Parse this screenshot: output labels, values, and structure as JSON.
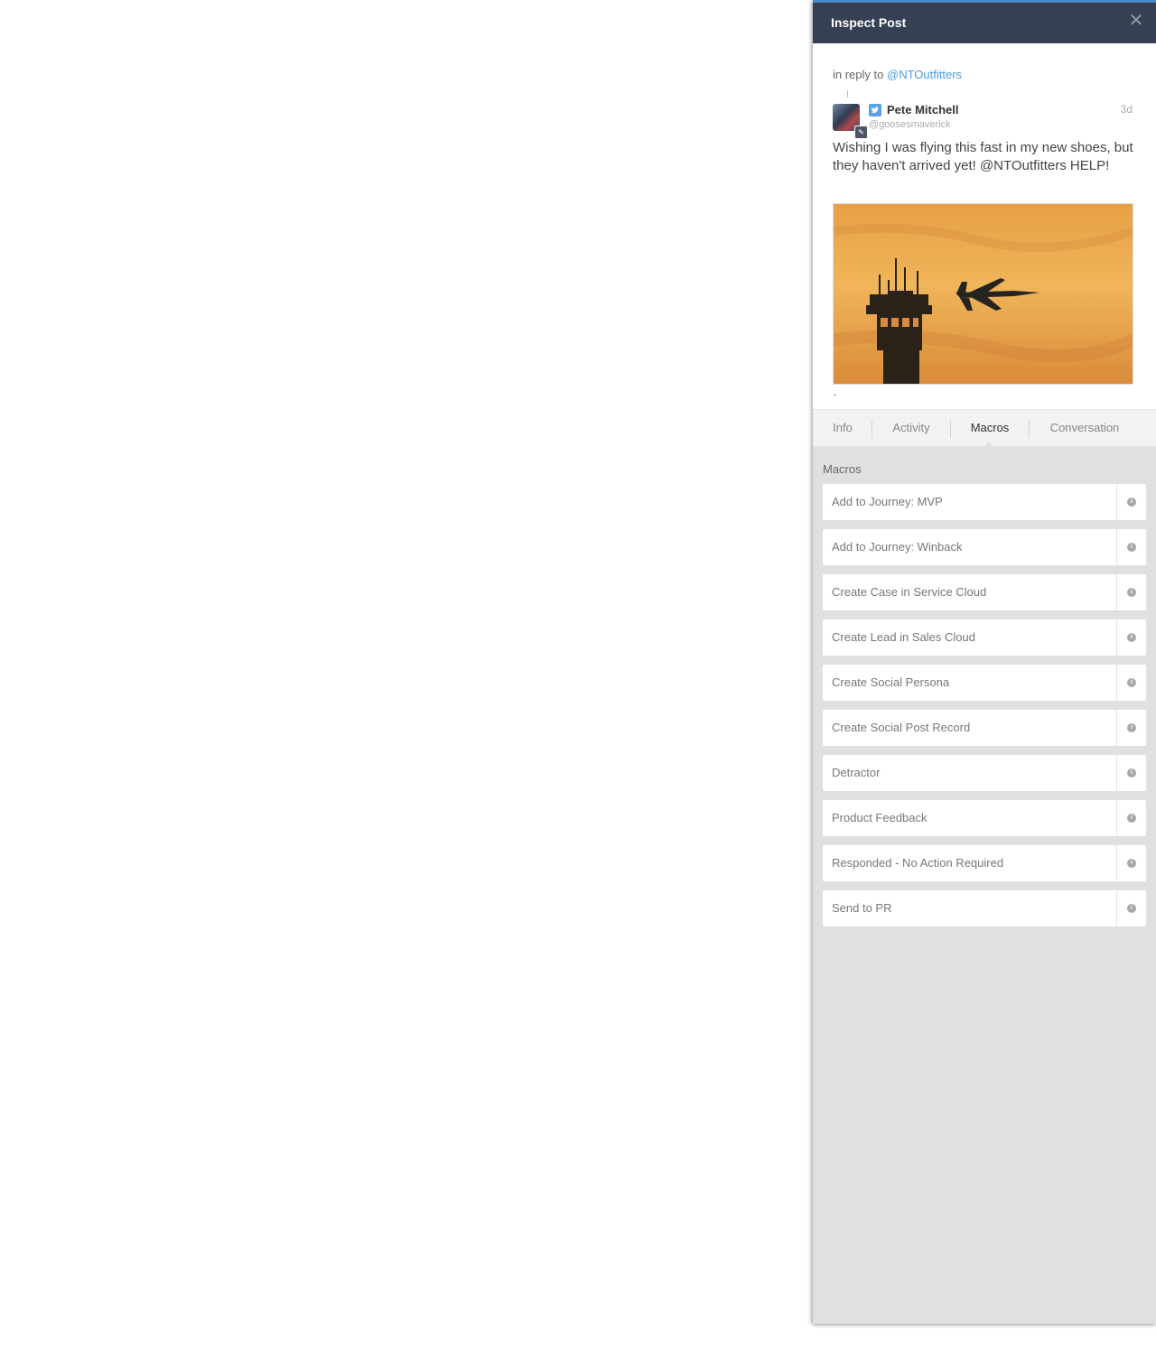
{
  "panel": {
    "title": "Inspect Post",
    "close_icon": "close-icon"
  },
  "post": {
    "reply_prefix": "in reply to",
    "reply_to": "@NTOutfitters",
    "author_name": "Pete Mitchell",
    "author_handle": "@goosesmaverick",
    "network_icon": "twitter-icon",
    "time": "3d",
    "text": "Wishing I was flying this fast in my new shoes, but they haven't arrived yet! @NTOutfitters HELP!",
    "image_icon": "post-photo-jet-and-control-tower"
  },
  "tabs": [
    {
      "label": "Info",
      "active": false
    },
    {
      "label": "Activity",
      "active": false
    },
    {
      "label": "Macros",
      "active": true
    },
    {
      "label": "Conversation",
      "active": false
    }
  ],
  "macros": {
    "heading": "Macros",
    "items": [
      {
        "label": "Add to Journey: MVP"
      },
      {
        "label": "Add to Journey: Winback"
      },
      {
        "label": "Create Case in Service Cloud"
      },
      {
        "label": "Create Lead in Sales Cloud"
      },
      {
        "label": "Create Social Persona"
      },
      {
        "label": "Create Social Post Record"
      },
      {
        "label": "Detractor"
      },
      {
        "label": "Product Feedback"
      },
      {
        "label": "Responded - No Action Required"
      },
      {
        "label": "Send to PR"
      }
    ]
  },
  "colors": {
    "header_bg": "#354052",
    "header_accent": "#4a88c8",
    "link": "#4a9be0",
    "panel_bg": "#e0e0e0"
  }
}
